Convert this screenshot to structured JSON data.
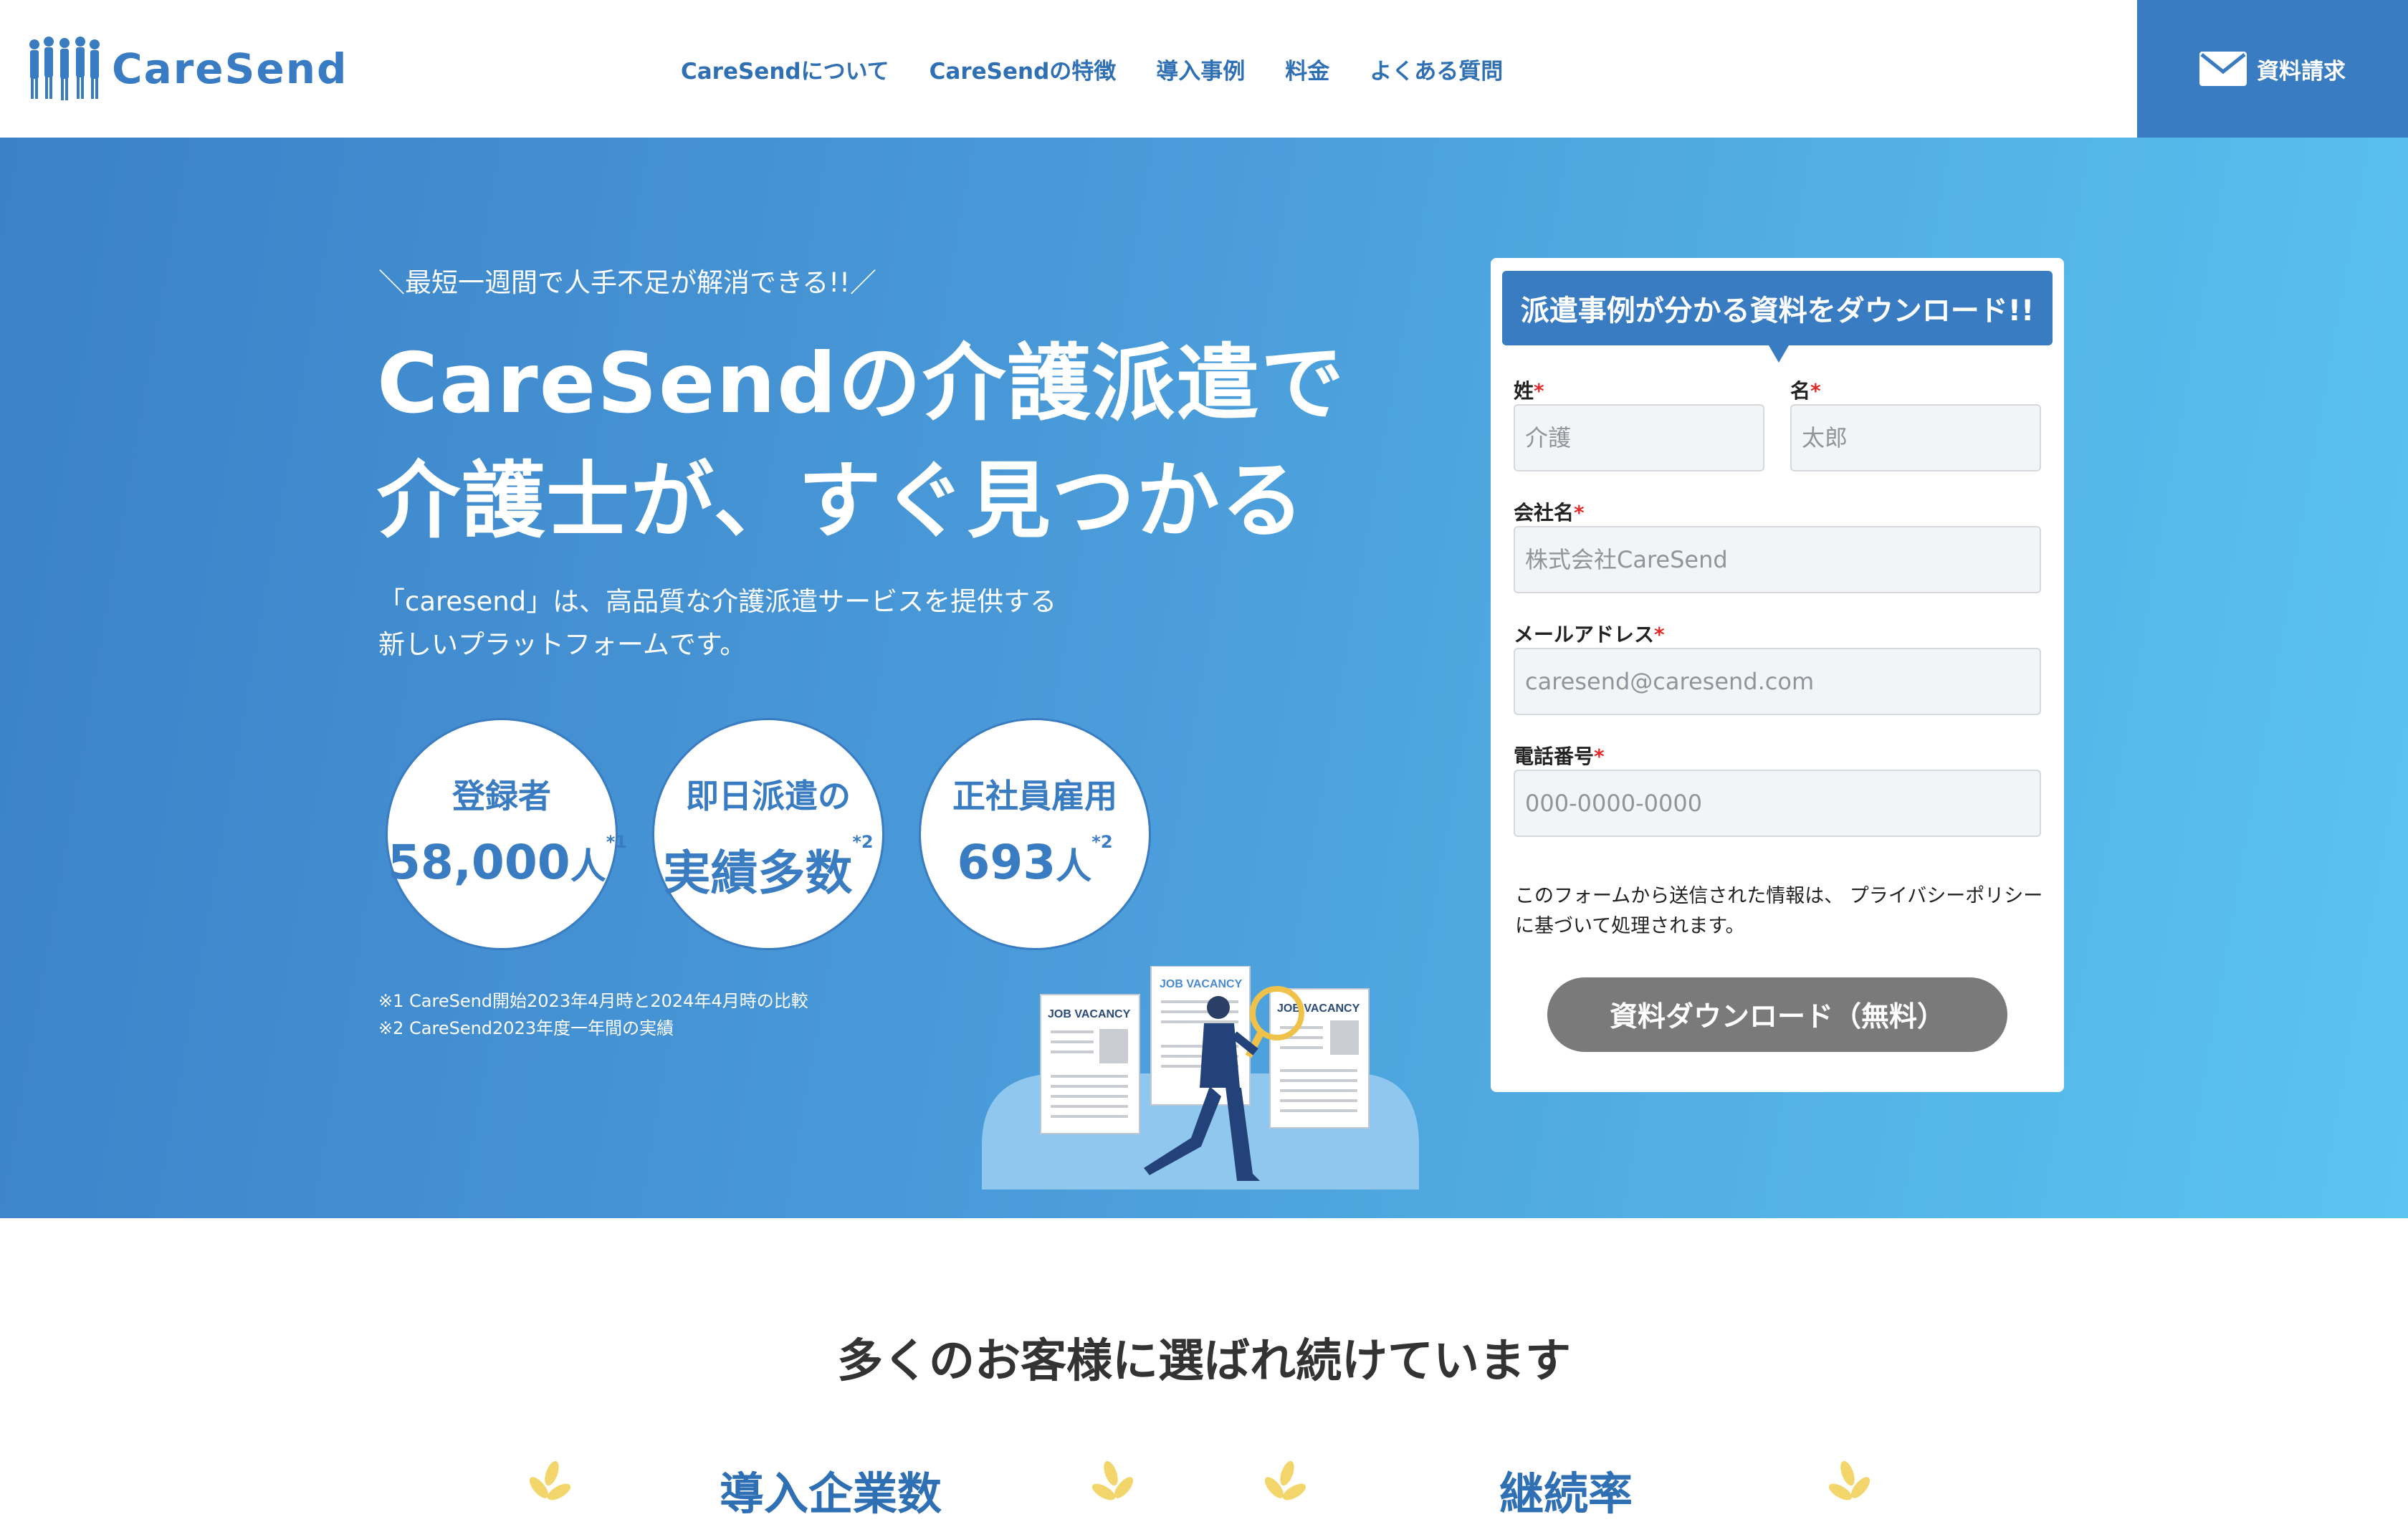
{
  "header": {
    "brand": "CareSend",
    "nav": [
      "CareSendについて",
      "CareSendの特徴",
      "導入事例",
      "料金",
      "よくある質問"
    ],
    "request_button": "資料請求"
  },
  "hero": {
    "subtitle": "＼最短一週間で人手不足が解消できる!!／",
    "title_line1": "CareSendの介護派遣で",
    "title_line2": "介護士が、すぐ見つかる",
    "desc_line1": "「caresend」は、高品質な介護派遣サービスを提供する",
    "desc_line2": "新しいプラットフォームです。",
    "stats": [
      {
        "label": "登録者",
        "value": "58,000",
        "unit": "人",
        "note": "*1"
      },
      {
        "label": "即日派遣の",
        "value": "実績多数",
        "unit": "",
        "note": "*2"
      },
      {
        "label": "正社員雇用",
        "value": "693",
        "unit": "人",
        "note": "*2"
      }
    ],
    "footnote1": "※1 CareSend開始2023年4月時と2024年4月時の比較",
    "footnote2": "※2 CareSend2023年度一年間の実績",
    "illustration_label": "JOB VACANCY"
  },
  "form": {
    "heading": "派遣事例が分かる資料をダウンロード!!",
    "required_mark": "*",
    "last_name_label": "姓",
    "last_name_placeholder": "介護",
    "first_name_label": "名",
    "first_name_placeholder": "太郎",
    "company_label": "会社名",
    "company_placeholder": "株式会社CareSend",
    "email_label": "メールアドレス",
    "email_placeholder": "caresend@caresend.com",
    "phone_label": "電話番号",
    "phone_placeholder": "000-0000-0000",
    "privacy_text": "このフォームから送信された情報は、 プライバシーポリシー に基づいて処理されます。",
    "submit_label": "資料ダウンロード（無料）"
  },
  "section": {
    "title": "多くのお客様に選ばれ続けています",
    "award1": "導入企業数",
    "award2": "継続率"
  },
  "colors": {
    "brand_blue": "#3a7cc2",
    "hero_gradient_start": "#3b81c8",
    "hero_gradient_end": "#5bc4f0",
    "submit_gray": "#7a7a7a",
    "required_red": "#e02b2b"
  }
}
